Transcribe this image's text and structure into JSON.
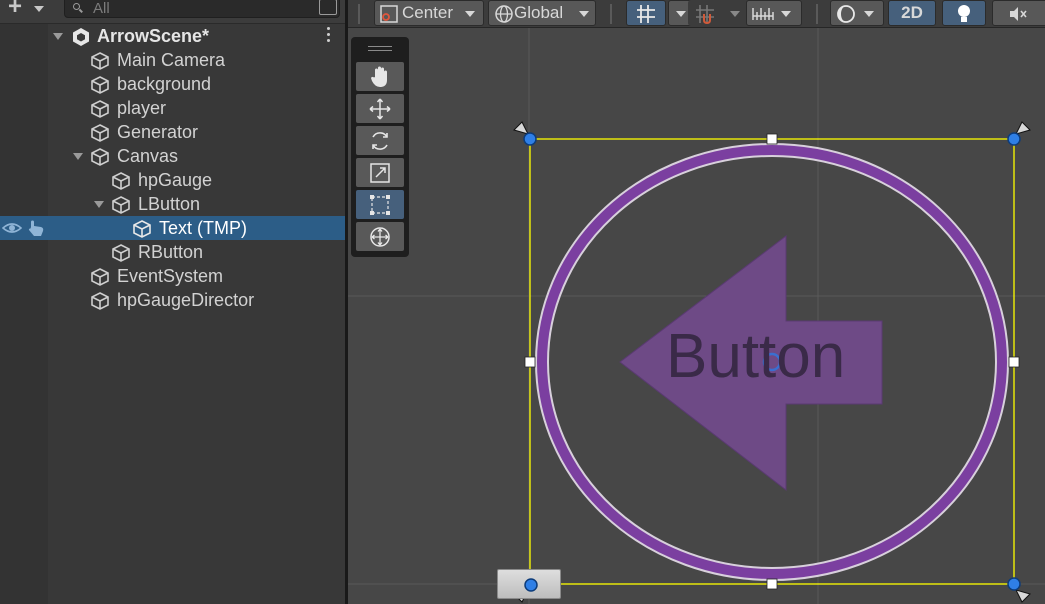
{
  "hierarchy": {
    "search": {
      "placeholder": "All",
      "value": ""
    },
    "scene": {
      "name": "ArrowScene*"
    },
    "items": [
      {
        "label": "Main Camera"
      },
      {
        "label": "background"
      },
      {
        "label": "player"
      },
      {
        "label": "Generator"
      },
      {
        "label": "Canvas"
      },
      {
        "label": "hpGauge"
      },
      {
        "label": "LButton"
      },
      {
        "label": "Text (TMP)"
      },
      {
        "label": "RButton"
      },
      {
        "label": "EventSystem"
      },
      {
        "label": "hpGaugeDirector"
      }
    ],
    "selected_item": "Text (TMP)"
  },
  "scene_toolbar": {
    "pivot_mode": "Center",
    "pivot_rotation": "Global",
    "mode_2d": "2D"
  },
  "scene": {
    "button_text": "Button"
  },
  "colors": {
    "selection": "#2c5d87",
    "accent_active": "#46607c",
    "purple": "#7b3fa0",
    "rect_outline": "#ffff00",
    "handle_blue": "#2f7fe6"
  },
  "icons": {
    "tools": [
      "hand-icon",
      "move-icon",
      "rotate-icon",
      "scale-icon",
      "rect-icon",
      "transform-icon"
    ]
  }
}
